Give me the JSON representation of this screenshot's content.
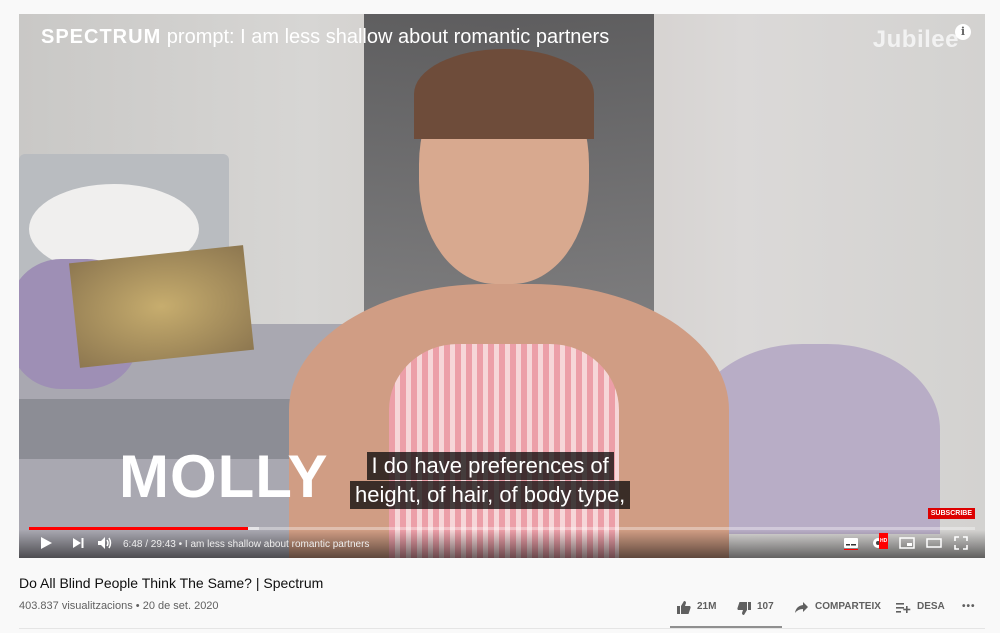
{
  "overlay": {
    "brand": "SPECTRUM",
    "prompt": "prompt: I am less shallow about romantic partners",
    "logo": "Jubilee",
    "name": "MOLLY"
  },
  "captions": [
    "I do have preferences of",
    "height, of hair, of body type,"
  ],
  "subscribe_label": "SUBSCRIBE",
  "player": {
    "progress_fraction": 0.231,
    "time": "6:48 / 29:43",
    "chapter": "• I am less shallow about romantic partners",
    "icons": [
      "play-icon",
      "next-icon",
      "volume-icon",
      "subtitles-icon",
      "settings-icon",
      "miniplayer-icon",
      "theater-icon",
      "fullscreen-icon"
    ],
    "hd_badge": "HD"
  },
  "video": {
    "title": "Do All Blind People Think The Same? | Spectrum",
    "meta": "403.837 visualitzacions • 20 de set. 2020"
  },
  "actions": {
    "likes": "21M",
    "dislikes": "107",
    "share": "COMPARTEIX",
    "save": "DESA",
    "more": "•••"
  },
  "colors": {
    "progress": "#ff0000",
    "subscribe": "#dd0000"
  }
}
